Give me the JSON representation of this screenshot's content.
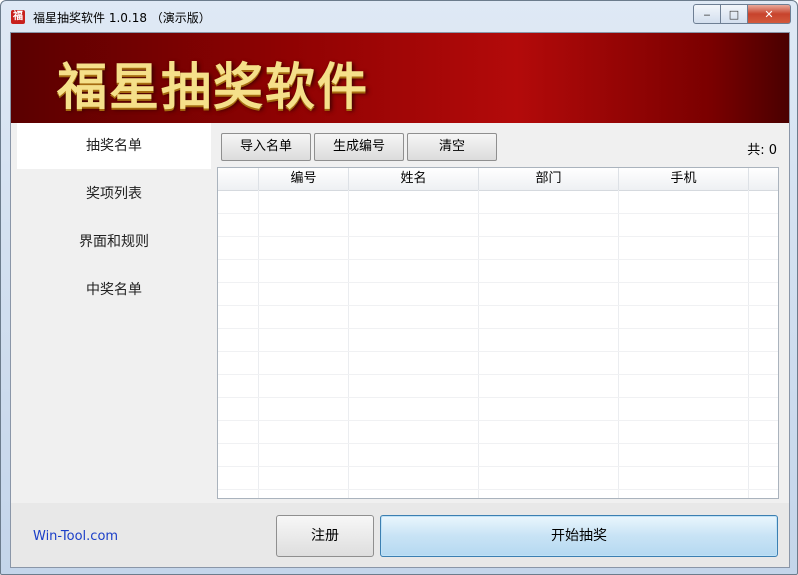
{
  "window": {
    "title": "福星抽奖软件 1.0.18 （演示版）",
    "icon_glyph": "福",
    "caption": {
      "minimize": "‒",
      "maximize": "□",
      "close": "✕"
    }
  },
  "banner": {
    "title": "福星抽奖软件"
  },
  "sidebar": {
    "items": [
      {
        "label": "抽奖名单",
        "active": true
      },
      {
        "label": "奖项列表",
        "active": false
      },
      {
        "label": "界面和规则",
        "active": false
      },
      {
        "label": "中奖名单",
        "active": false
      }
    ]
  },
  "toolbar": {
    "import_label": "导入名单",
    "generate_label": "生成编号",
    "clear_label": "清空",
    "count_label": "共: 0"
  },
  "table": {
    "columns": [
      "",
      "编号",
      "姓名",
      "部门",
      "手机"
    ],
    "rows": []
  },
  "footer": {
    "link": "Win-Tool.com",
    "register_label": "注册",
    "start_label": "开始抽奖"
  },
  "colors": {
    "banner_red": "#b30a0a",
    "banner_text": "#f5e08a",
    "link": "#1a3ec8"
  }
}
